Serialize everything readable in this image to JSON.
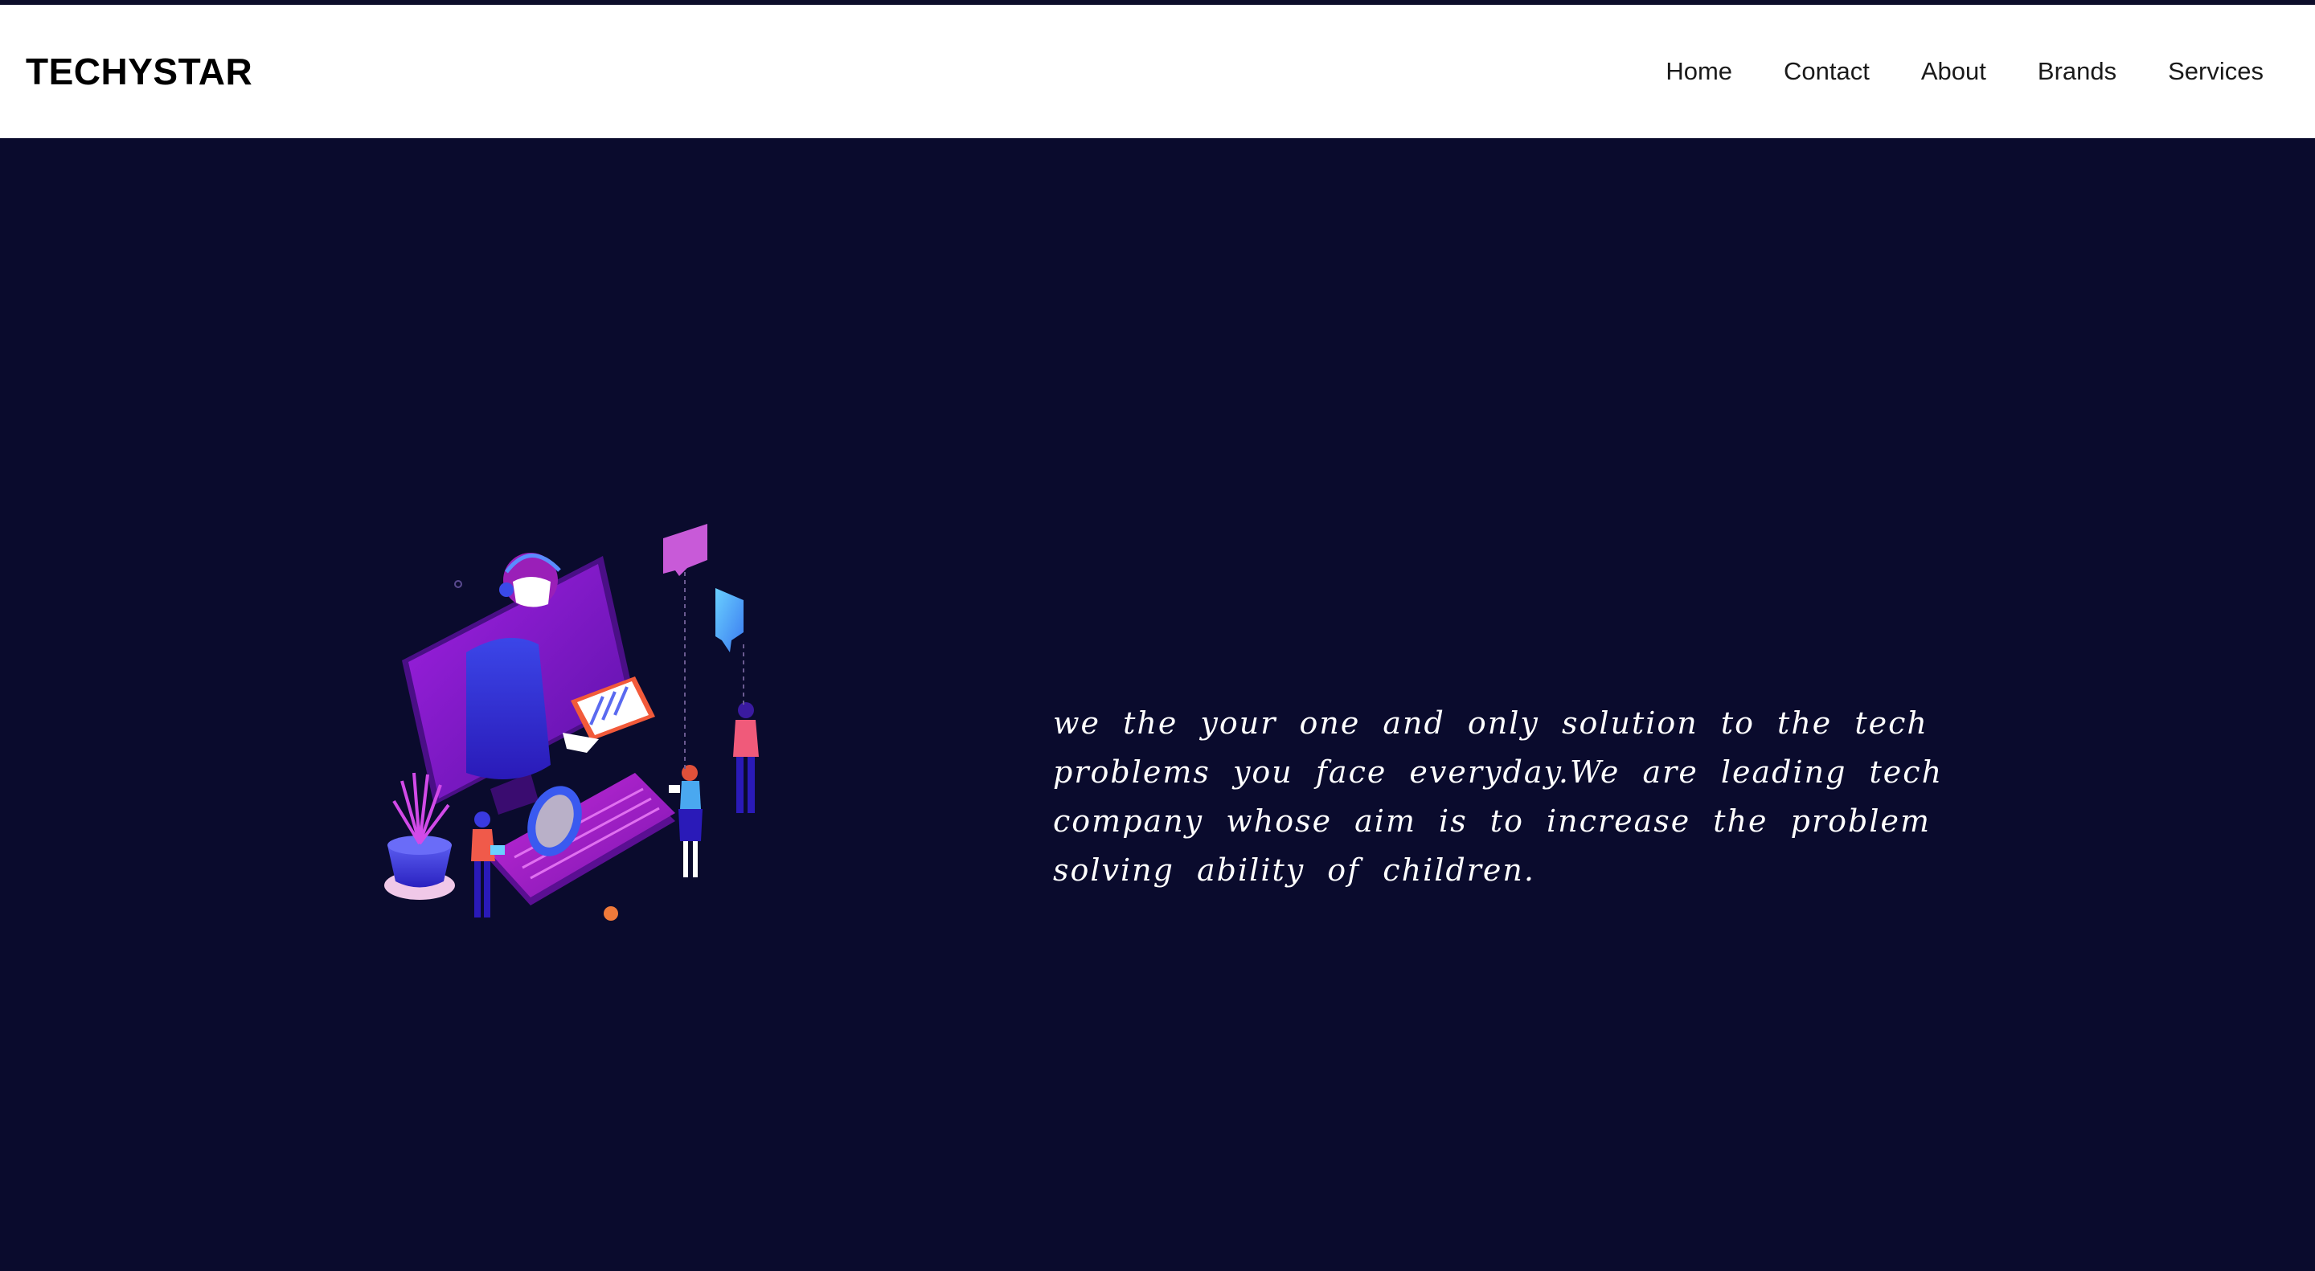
{
  "header": {
    "brand": "TECHYSTAR",
    "nav": [
      "Home",
      "Contact",
      "About",
      "Brands",
      "Services"
    ]
  },
  "hero": {
    "tagline": "we the your one and only solution to the tech problems you face everyday.We are leading tech company whose aim is to increase the problem solving ability of children."
  },
  "colors": {
    "background": "#0a0b2d",
    "navbar": "#ffffff",
    "accent_purple": "#8a1fd0",
    "accent_blue": "#3a3fe0"
  }
}
